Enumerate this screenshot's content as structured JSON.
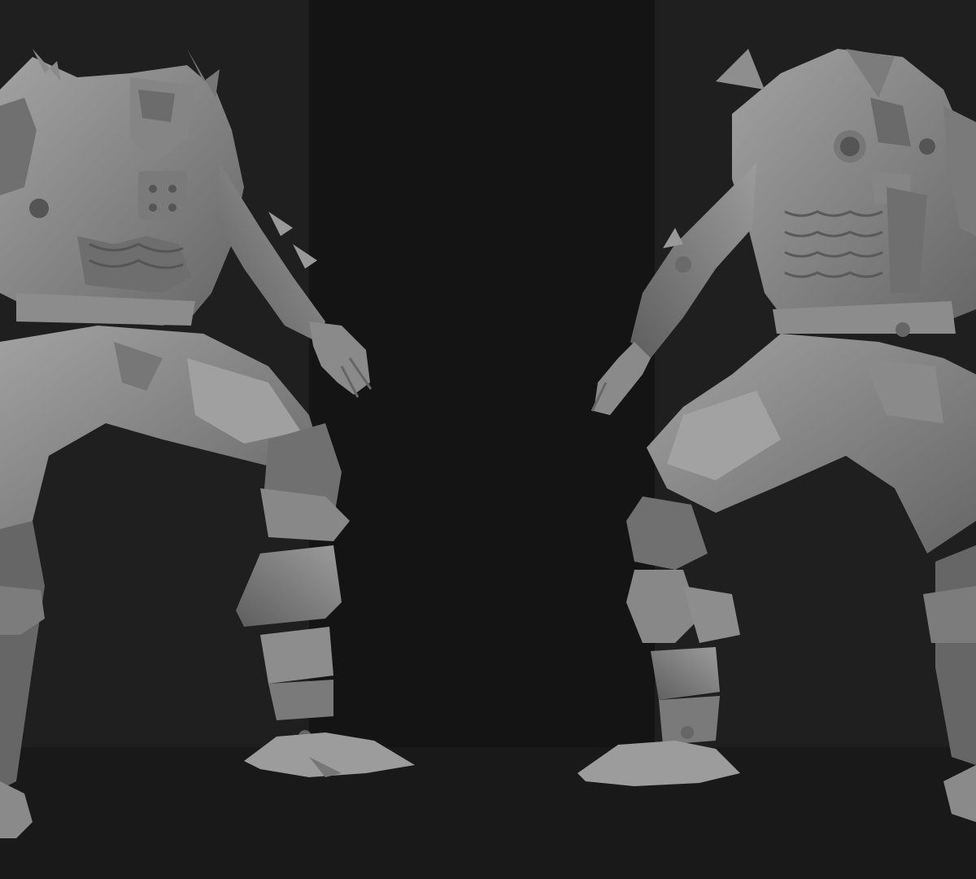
{
  "scene": {
    "description_visible_text": "",
    "colors": {
      "backdrop_side": "#1f1f1f",
      "backdrop_center": "#141414",
      "floor": "#191919",
      "clay_light": "#9a9a9a",
      "clay_mid": "#7b7b7b",
      "clay_dark": "#555555",
      "clay_shadow": "#3a3a3a"
    },
    "figures": [
      {
        "view": "front",
        "icon": "armored-character-sculpt"
      },
      {
        "view": "back",
        "icon": "armored-character-sculpt"
      }
    ]
  }
}
